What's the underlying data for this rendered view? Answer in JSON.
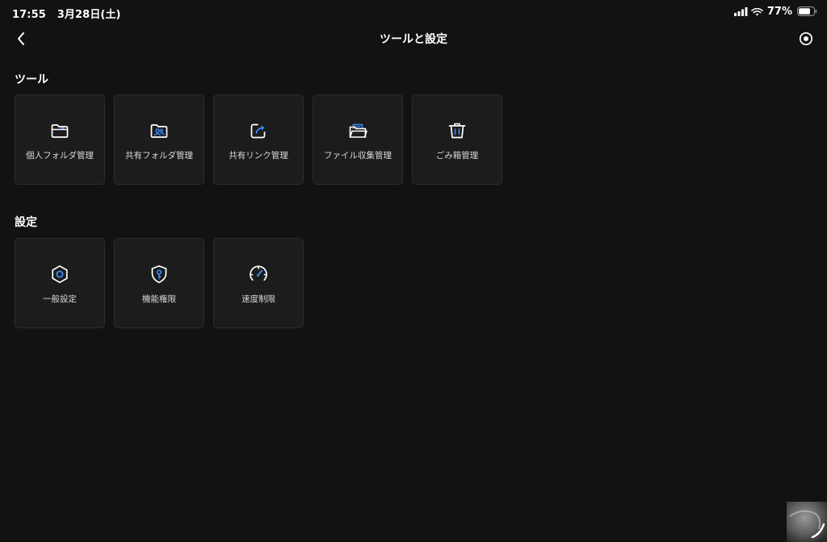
{
  "status_bar": {
    "time": "17:55",
    "date": "3月28日(土)",
    "battery_percent": "77%",
    "battery_level": 0.77,
    "icons": [
      "signal-icon",
      "wifi-icon",
      "battery-icon"
    ]
  },
  "nav": {
    "title": "ツールと設定",
    "back_icon": "chevron-left-icon",
    "right_icon": "target-icon"
  },
  "tools": {
    "title": "ツール",
    "items": [
      {
        "label": "個人フォルダ管理",
        "icon": "personal-folder-icon"
      },
      {
        "label": "共有フォルダ管理",
        "icon": "shared-folder-icon"
      },
      {
        "label": "共有リンク管理",
        "icon": "share-link-icon"
      },
      {
        "label": "ファイル収集管理",
        "icon": "file-collection-icon"
      },
      {
        "label": "ごみ箱管理",
        "icon": "trash-icon"
      }
    ]
  },
  "settings": {
    "title": "設定",
    "items": [
      {
        "label": "一般設定",
        "icon": "general-settings-icon"
      },
      {
        "label": "機能権限",
        "icon": "permissions-shield-icon"
      },
      {
        "label": "速度制限",
        "icon": "speedometer-icon"
      }
    ]
  },
  "colors": {
    "background": "#121212",
    "card_bg": "#1c1c1c",
    "card_border": "#2c2c2c",
    "text": "#ffffff",
    "label_text": "#d8d8d8",
    "accent": "#3d8bff"
  }
}
